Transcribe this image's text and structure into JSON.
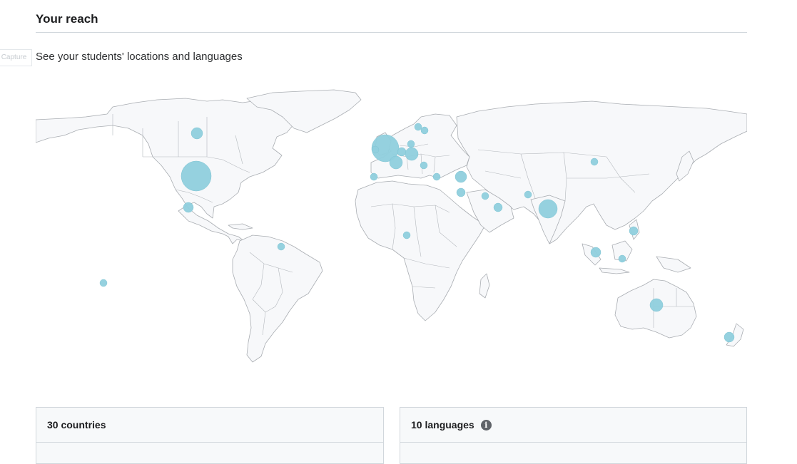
{
  "reach": {
    "title": "Your reach",
    "capture_label": "Capture",
    "subtitle": "See your students' locations and languages"
  },
  "map": {
    "name": "world-map",
    "land_color": "#f7f8fa",
    "bubble_color": "#8fcfdd",
    "student_bubbles": [
      {
        "region": "Canada",
        "size": "small"
      },
      {
        "region": "United States",
        "size": "large"
      },
      {
        "region": "Mexico",
        "size": "small"
      },
      {
        "region": "Hawaii",
        "size": "small"
      },
      {
        "region": "Trinidad and Tobago",
        "size": "small"
      },
      {
        "region": "United Kingdom",
        "size": "large"
      },
      {
        "region": "Ireland",
        "size": "small"
      },
      {
        "region": "France",
        "size": "medium"
      },
      {
        "region": "Portugal",
        "size": "small"
      },
      {
        "region": "Norway",
        "size": "small"
      },
      {
        "region": "Sweden",
        "size": "small"
      },
      {
        "region": "Netherlands",
        "size": "small"
      },
      {
        "region": "Germany",
        "size": "medium"
      },
      {
        "region": "Poland",
        "size": "small"
      },
      {
        "region": "Italy",
        "size": "small"
      },
      {
        "region": "Greece",
        "size": "small"
      },
      {
        "region": "Turkey",
        "size": "medium"
      },
      {
        "region": "Israel",
        "size": "small"
      },
      {
        "region": "Iraq",
        "size": "small"
      },
      {
        "region": "UAE",
        "size": "small"
      },
      {
        "region": "Pakistan",
        "size": "small"
      },
      {
        "region": "India",
        "size": "large"
      },
      {
        "region": "Mongolia",
        "size": "small"
      },
      {
        "region": "Philippines",
        "size": "small"
      },
      {
        "region": "Malaysia",
        "size": "small"
      },
      {
        "region": "Indonesia",
        "size": "small"
      },
      {
        "region": "Nigeria",
        "size": "small"
      },
      {
        "region": "Australia",
        "size": "medium"
      },
      {
        "region": "New Zealand",
        "size": "small"
      }
    ]
  },
  "cards": {
    "countries_label": "30 countries",
    "languages_label": "10 languages",
    "info_icon_glyph": "i"
  }
}
